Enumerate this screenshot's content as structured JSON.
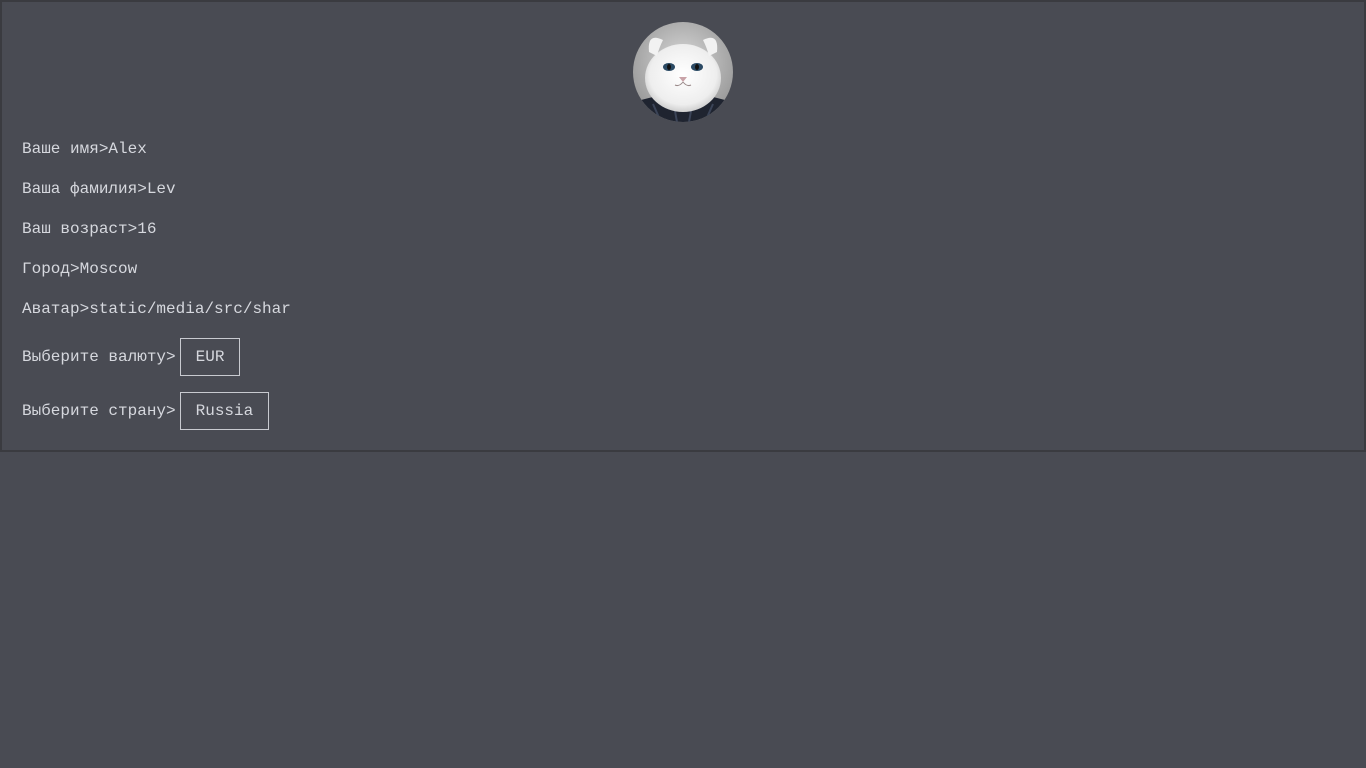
{
  "profile": {
    "avatar_icon": "cat-avatar",
    "fields": [
      {
        "label": "Ваше имя>",
        "value": "Alex"
      },
      {
        "label": "Ваша фамилия>",
        "value": "Lev"
      },
      {
        "label": "Ваш возраст>",
        "value": "16"
      },
      {
        "label": "Город>",
        "value": "Moscow"
      },
      {
        "label": "Аватар>",
        "value": "static/media/src/shar"
      }
    ],
    "currency": {
      "label": "Выберите валюту>",
      "selected": "EUR"
    },
    "country": {
      "label": "Выберите страну>",
      "selected": "Russia"
    }
  },
  "colors": {
    "background": "#494b53",
    "text": "#d6d8de",
    "border": "#3a3b40"
  }
}
